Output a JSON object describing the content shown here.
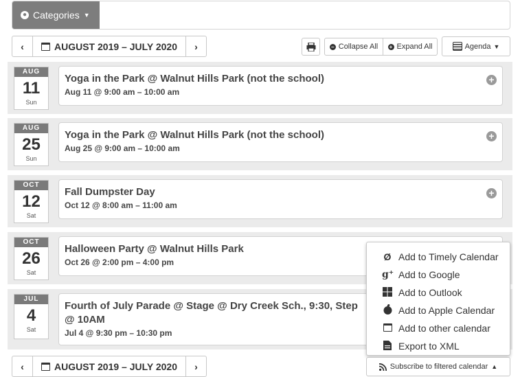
{
  "categories": {
    "label": "Categories"
  },
  "nav": {
    "prev": "‹",
    "next": "›",
    "range": "AUGUST 2019 – JULY 2020"
  },
  "toolbar": {
    "collapse": "Collapse All",
    "expand": "Expand All",
    "view": "Agenda"
  },
  "events": [
    {
      "mon": "AUG",
      "day": "11",
      "wd": "Sun",
      "title": "Yoga in the Park @ Walnut Hills Park (not the school)",
      "title2": "",
      "time": "Aug 11 @ 9:00 am – 10:00 am"
    },
    {
      "mon": "AUG",
      "day": "25",
      "wd": "Sun",
      "title": "Yoga in the Park @ Walnut Hills Park (not the school)",
      "title2": "",
      "time": "Aug 25 @ 9:00 am – 10:00 am"
    },
    {
      "mon": "OCT",
      "day": "12",
      "wd": "Sat",
      "title": "Fall Dumpster Day",
      "title2": "",
      "time": "Oct 12 @ 8:00 am – 11:00 am"
    },
    {
      "mon": "OCT",
      "day": "26",
      "wd": "Sat",
      "title": "Halloween Party @ Walnut Hills Park",
      "title2": "",
      "time": "Oct 26 @ 2:00 pm – 4:00 pm"
    },
    {
      "mon": "JUL",
      "day": "4",
      "wd": "Sat",
      "title": "Fourth of July Parade @ Stage @ Dry Creek Sch., 9:30, Step",
      "title2": "@ 10AM",
      "time": "Jul 4 @ 9:30 pm – 10:30 pm"
    }
  ],
  "menu": {
    "items": [
      {
        "label": "Add to Timely Calendar",
        "icon": "timely-icon"
      },
      {
        "label": "Add to Google",
        "icon": "google-plus-icon"
      },
      {
        "label": "Add to Outlook",
        "icon": "windows-icon"
      },
      {
        "label": "Add to Apple Calendar",
        "icon": "apple-icon"
      },
      {
        "label": "Add to other calendar",
        "icon": "calendar-icon"
      },
      {
        "label": "Export to XML",
        "icon": "file-icon"
      }
    ]
  },
  "subscribe": {
    "label": "Subscribe to filtered calendar"
  }
}
